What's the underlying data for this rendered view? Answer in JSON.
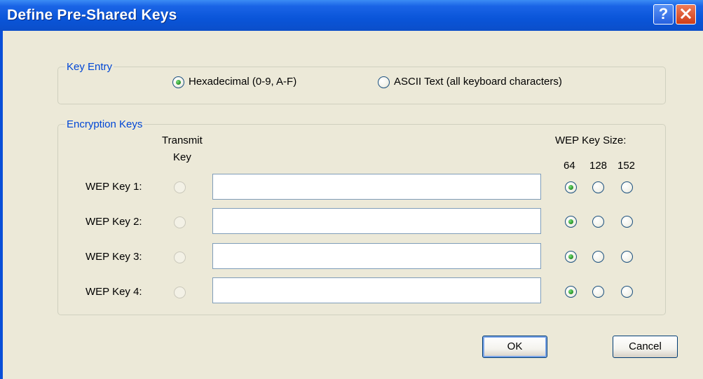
{
  "window": {
    "title": "Define Pre-Shared Keys",
    "help_icon": "question-icon",
    "close_icon": "close-x-icon"
  },
  "key_entry": {
    "legend": "Key Entry",
    "options": [
      {
        "label": "Hexadecimal (0-9, A-F)",
        "checked": true
      },
      {
        "label": "ASCII Text (all keyboard characters)",
        "checked": false
      }
    ]
  },
  "encryption_keys": {
    "legend": "Encryption Keys",
    "transmit_header_line1": "Transmit",
    "transmit_header_line2": "Key",
    "size_header": "WEP Key Size:",
    "sizes": [
      "64",
      "128",
      "152"
    ],
    "rows": [
      {
        "label": "WEP Key 1:",
        "value": "",
        "selected_size": "64"
      },
      {
        "label": "WEP Key 2:",
        "value": "",
        "selected_size": "64"
      },
      {
        "label": "WEP Key 3:",
        "value": "",
        "selected_size": "64"
      },
      {
        "label": "WEP Key 4:",
        "value": "",
        "selected_size": "64"
      }
    ]
  },
  "buttons": {
    "ok": "OK",
    "cancel": "Cancel"
  },
  "colors": {
    "title_bar": "#0a55d9",
    "dialog_bg": "#ece9d8",
    "group_legend": "#0046d5",
    "radio_check": "#2f9b2f"
  }
}
